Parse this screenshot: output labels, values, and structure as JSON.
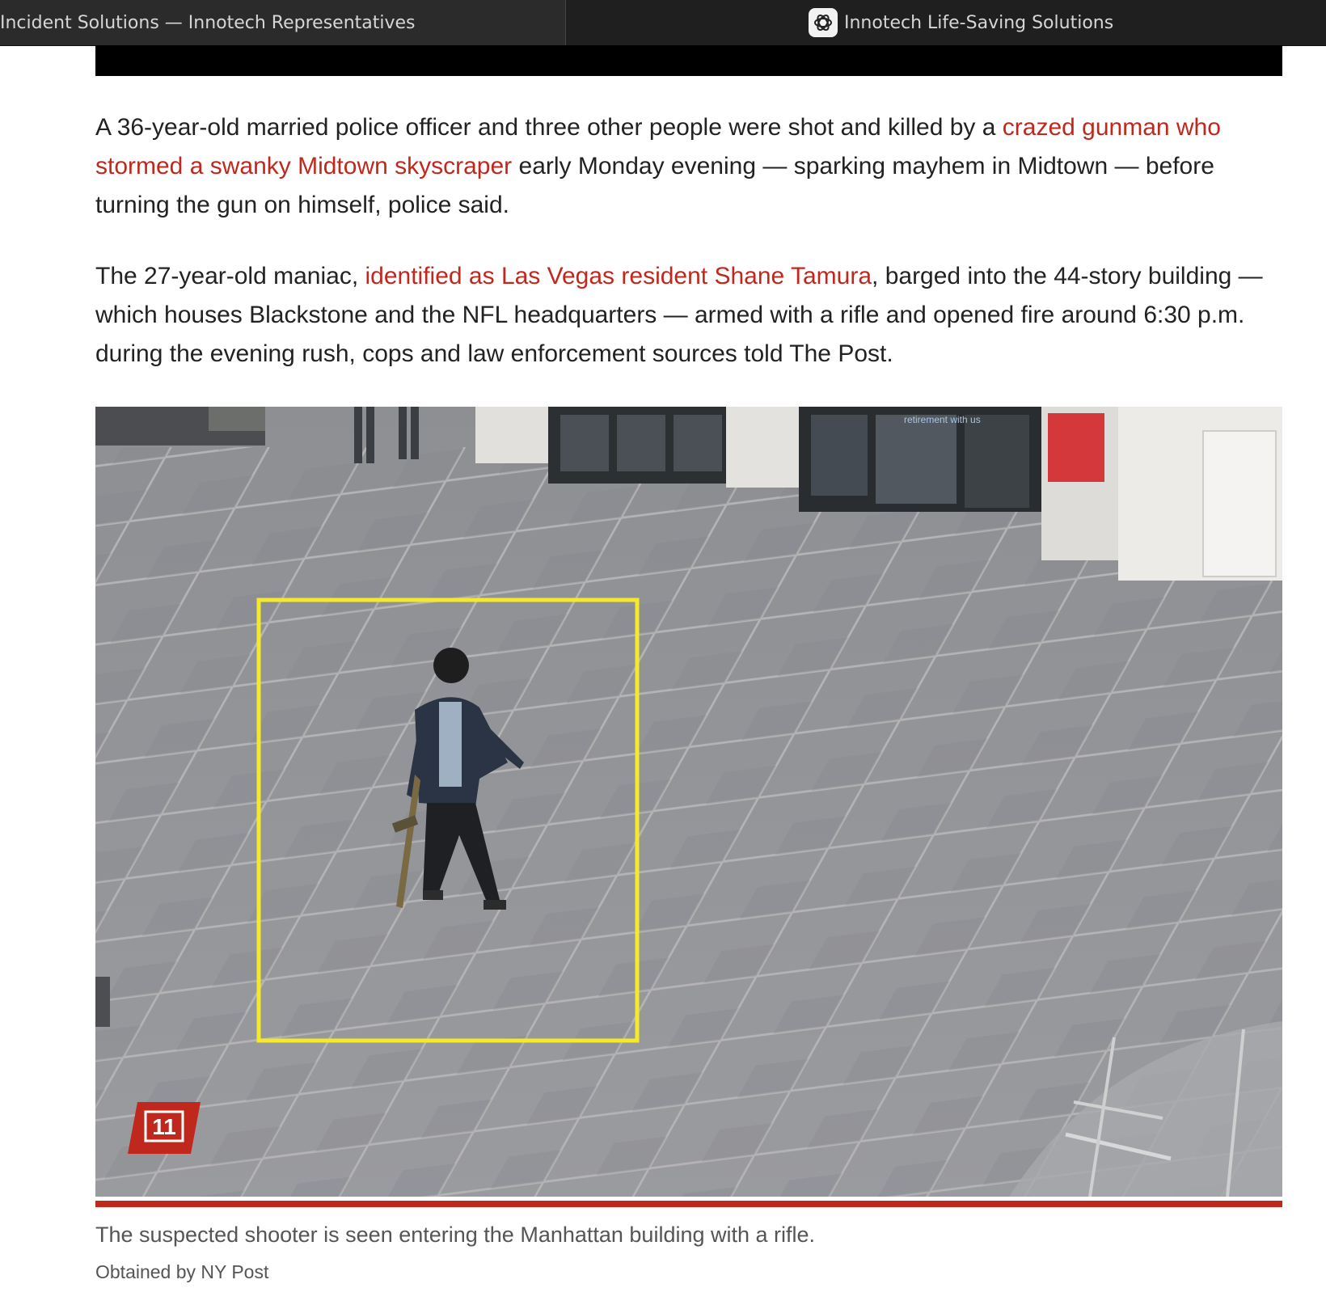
{
  "tabs": {
    "left_title": "Incident Solutions — Innotech Representatives",
    "right_title": "Innotech Life-Saving Solutions",
    "right_icon": "openai-logo-icon"
  },
  "article": {
    "p1": {
      "before": "A 36-year-old married police officer and three other people were shot and killed by a ",
      "link": "crazed gunman who stormed a swanky Midtown skyscraper",
      "after": " early Monday evening — sparking mayhem in Midtown — before turning the gun on himself, police said."
    },
    "p2": {
      "before": "The 27-year-old maniac, ",
      "link": "identified as Las Vegas resident Shane Tamura",
      "after": ", barged into the 44-story building — which houses Blackstone and the NFL headquarters — armed with a rifle and opened fire around 6:30 p.m. during the evening rush, cops and law enforcement sources told The Post."
    },
    "link_color": "#c0281d"
  },
  "photo": {
    "gallery_badge": "11",
    "storefront_text": "retirement with us",
    "highlight_color": "#f5ea2a",
    "caption": "The suspected shooter is seen entering the Manhattan building with a rifle.",
    "credit": "Obtained by NY Post"
  }
}
